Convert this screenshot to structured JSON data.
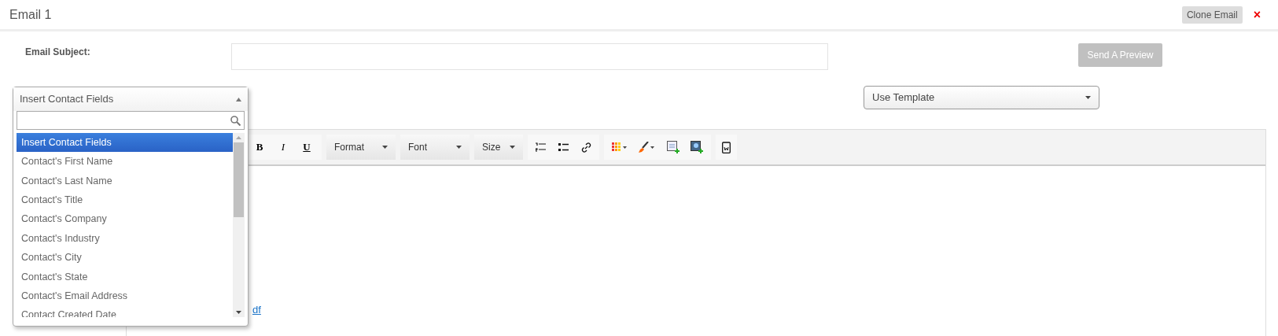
{
  "header": {
    "title": "Email 1",
    "clone_button": "Clone Email",
    "close_label": "×"
  },
  "subject": {
    "label": "Email Subject:"
  },
  "preview_button": "Send A Preview",
  "contact_fields": {
    "label": "Insert Contact Fields",
    "expanded": true,
    "options": [
      {
        "label": "Insert Contact Fields",
        "selected": true
      },
      {
        "label": "Contact's First Name",
        "selected": false
      },
      {
        "label": "Contact's Last Name",
        "selected": false
      },
      {
        "label": "Contact's Title",
        "selected": false
      },
      {
        "label": "Contact's Company",
        "selected": false
      },
      {
        "label": "Contact's Industry",
        "selected": false
      },
      {
        "label": "Contact's City",
        "selected": false
      },
      {
        "label": "Contact's State",
        "selected": false
      },
      {
        "label": "Contact's Email Address",
        "selected": false
      },
      {
        "label": "Contact Created Date",
        "selected": false
      }
    ]
  },
  "template_select": {
    "label": "Use Template"
  },
  "toolbar": {
    "format_buttons": [
      {
        "kind": "bold",
        "label": "B"
      },
      {
        "kind": "italic",
        "label": "I"
      },
      {
        "kind": "underline",
        "label": "U"
      }
    ],
    "dropdowns": [
      {
        "label": "Format"
      },
      {
        "label": "Font"
      },
      {
        "label": "Size"
      }
    ]
  },
  "editor": {
    "link_text": "df"
  }
}
